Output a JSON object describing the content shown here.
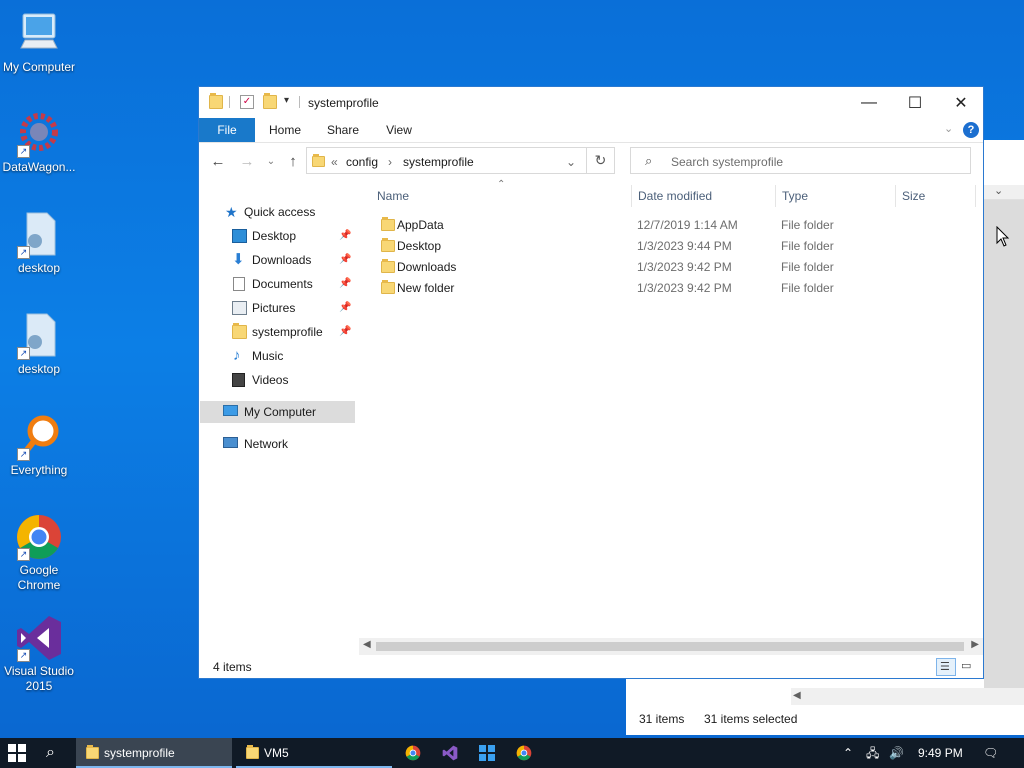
{
  "desktop": {
    "icons": [
      {
        "label": "My Computer",
        "icon": "computer-icon"
      },
      {
        "label": "DataWagon...",
        "icon": "gear-icon"
      },
      {
        "label": "desktop",
        "icon": "file-icon"
      },
      {
        "label": "desktop",
        "icon": "file-icon"
      },
      {
        "label": "Everything",
        "icon": "magnifier-icon"
      },
      {
        "label": "Google Chrome",
        "icon": "chrome-icon"
      },
      {
        "label": "Visual Studio 2015",
        "icon": "visual-studio-icon"
      }
    ]
  },
  "background_window": {
    "status": {
      "items": "31 items",
      "selected": "31 items selected"
    }
  },
  "window": {
    "title": "systemprofile",
    "controls": {
      "minimize": "—",
      "maximize": "☐",
      "close": "✕"
    },
    "ribbon_tabs": [
      "File",
      "Home",
      "Share",
      "View"
    ],
    "help": "?",
    "address": {
      "overflow": "«",
      "crumbs": [
        "config",
        "systemprofile"
      ]
    },
    "search_placeholder": "Search systemprofile",
    "nav_pane": {
      "quick_access": "Quick access",
      "items": [
        {
          "label": "Desktop",
          "pinned": true
        },
        {
          "label": "Downloads",
          "pinned": true
        },
        {
          "label": "Documents",
          "pinned": true
        },
        {
          "label": "Pictures",
          "pinned": true
        },
        {
          "label": "systemprofile",
          "pinned": true
        },
        {
          "label": "Music",
          "pinned": false
        },
        {
          "label": "Videos",
          "pinned": false
        }
      ],
      "my_computer": "My Computer",
      "network": "Network"
    },
    "columns": [
      "Name",
      "Date modified",
      "Type",
      "Size"
    ],
    "files": [
      {
        "name": "AppData",
        "date": "12/7/2019 1:14 AM",
        "type": "File folder"
      },
      {
        "name": "Desktop",
        "date": "1/3/2023 9:44 PM",
        "type": "File folder"
      },
      {
        "name": "Downloads",
        "date": "1/3/2023 9:42 PM",
        "type": "File folder"
      },
      {
        "name": "New folder",
        "date": "1/3/2023 9:42 PM",
        "type": "File folder"
      }
    ],
    "status": "4 items"
  },
  "taskbar": {
    "items": [
      {
        "label": "systemprofile",
        "active": true
      },
      {
        "label": "VM5",
        "active": false
      }
    ],
    "time": "9:49 PM"
  },
  "colors": {
    "accent": "#1979ca",
    "desktop": "#0c7fe6",
    "taskbar": "#101a26"
  }
}
